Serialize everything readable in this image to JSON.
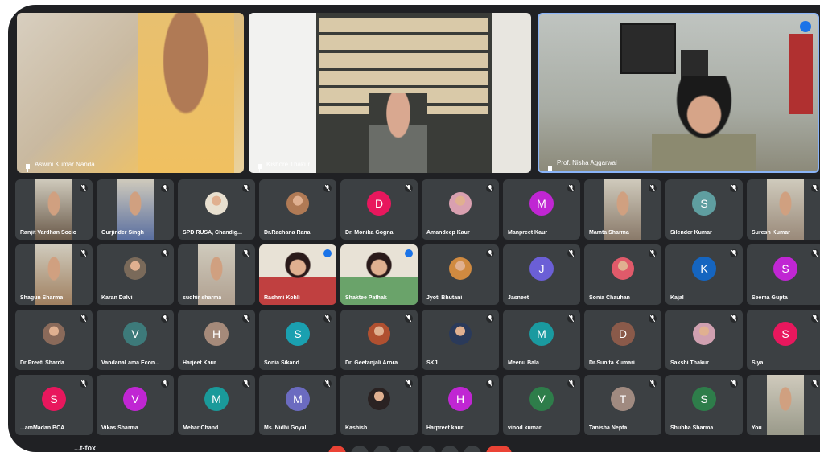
{
  "featured": [
    {
      "name": "Aswini Kumar Nanda"
    },
    {
      "name": "Kishore Thakur"
    },
    {
      "name": "Prof. Nisha Aggarwal"
    }
  ],
  "grid": [
    {
      "name": "Ranjit Vardhan Socio",
      "kind": "cam",
      "tone": "#6a5a4a"
    },
    {
      "name": "Gurjinder Singh",
      "kind": "cam",
      "tone": "#5a6fa0"
    },
    {
      "name": "SPD RUSA, Chandig...",
      "kind": "photo",
      "tone": "#e8e0d0"
    },
    {
      "name": "Dr.Rachana Rana",
      "kind": "photo",
      "tone": "#b07a55"
    },
    {
      "name": "Dr. Monika Gogna",
      "kind": "letter",
      "letter": "D",
      "color": "#e8175d"
    },
    {
      "name": "Amandeep Kaur",
      "kind": "photo",
      "tone": "#d9a0b0"
    },
    {
      "name": "Manpreet Kaur",
      "kind": "letter",
      "letter": "M",
      "color": "#c026d3"
    },
    {
      "name": "Mamta Sharma",
      "kind": "cam",
      "tone": "#8a7a6a"
    },
    {
      "name": "Silender Kumar",
      "kind": "letter",
      "letter": "S",
      "color": "#5f9ea0"
    },
    {
      "name": "Suresh Kumar",
      "kind": "cam",
      "tone": "#9a8a7a"
    },
    {
      "name": "Shagun Sharma",
      "kind": "cam",
      "tone": "#a08060"
    },
    {
      "name": "Karan Dalvi",
      "kind": "photo",
      "tone": "#7a6a5a"
    },
    {
      "name": "sudhir sharma",
      "kind": "cam",
      "tone": "#b0a090"
    },
    {
      "name": "Rashmi Kohli",
      "kind": "video",
      "tone": "#c04040"
    },
    {
      "name": "Shaktee Pathak",
      "kind": "video",
      "tone": "#6aa36a"
    },
    {
      "name": "Jyoti Bhutani",
      "kind": "photo",
      "tone": "#d08a40"
    },
    {
      "name": "Jasneet",
      "kind": "letter",
      "letter": "J",
      "color": "#6b5fd6"
    },
    {
      "name": "Sonia Chauhan",
      "kind": "photo",
      "tone": "#e05a6a"
    },
    {
      "name": "Kajal",
      "kind": "letter",
      "letter": "K",
      "color": "#1565c0"
    },
    {
      "name": "Seema Gupta",
      "kind": "letter",
      "letter": "S",
      "color": "#c026d3"
    },
    {
      "name": "Dr Preeti Sharda",
      "kind": "photo",
      "tone": "#8a6a5a"
    },
    {
      "name": "VandanaLama Econ...",
      "kind": "letter",
      "letter": "V",
      "color": "#3d7a7a"
    },
    {
      "name": "Harjeet Kaur",
      "kind": "letter",
      "letter": "H",
      "color": "#a58a7a"
    },
    {
      "name": "Sonia Sikand",
      "kind": "letter",
      "letter": "S",
      "color": "#1aa0b0"
    },
    {
      "name": "Dr. Geetanjali Arora",
      "kind": "photo",
      "tone": "#b05030"
    },
    {
      "name": "SKJ",
      "kind": "photo",
      "tone": "#2a3a5a"
    },
    {
      "name": "Meenu Bala",
      "kind": "letter",
      "letter": "M",
      "color": "#1a9aa0"
    },
    {
      "name": "Dr.Sunita Kumari",
      "kind": "letter",
      "letter": "D",
      "color": "#8a5a4a"
    },
    {
      "name": "Sakshi Thakur",
      "kind": "photo",
      "tone": "#d0a0b0"
    },
    {
      "name": "Siya",
      "kind": "letter",
      "letter": "S",
      "color": "#e8175d"
    },
    {
      "name": "...amMadan BCA",
      "kind": "letter",
      "letter": "S",
      "color": "#e8175d"
    },
    {
      "name": "Vikas Sharma",
      "kind": "letter",
      "letter": "V",
      "color": "#c026d3"
    },
    {
      "name": "Mehar Chand",
      "kind": "letter",
      "letter": "M",
      "color": "#1a9a9a"
    },
    {
      "name": "Ms. Nidhi Goyal",
      "kind": "letter",
      "letter": "M",
      "color": "#6b6bc0"
    },
    {
      "name": "Kashish",
      "kind": "photo",
      "tone": "#2a2222"
    },
    {
      "name": "Harpreet kaur",
      "kind": "letter",
      "letter": "H",
      "color": "#c026d3"
    },
    {
      "name": "vinod kumar",
      "kind": "letter",
      "letter": "V",
      "color": "#2e7d4a"
    },
    {
      "name": "Tanisha Nepta",
      "kind": "letter",
      "letter": "T",
      "color": "#a08a80"
    },
    {
      "name": "Shubha Sharma",
      "kind": "letter",
      "letter": "S",
      "color": "#2e7d4a"
    },
    {
      "name": "You",
      "kind": "cam",
      "tone": "#9a9a8a"
    }
  ],
  "bottom_left_label": "...t-fox"
}
